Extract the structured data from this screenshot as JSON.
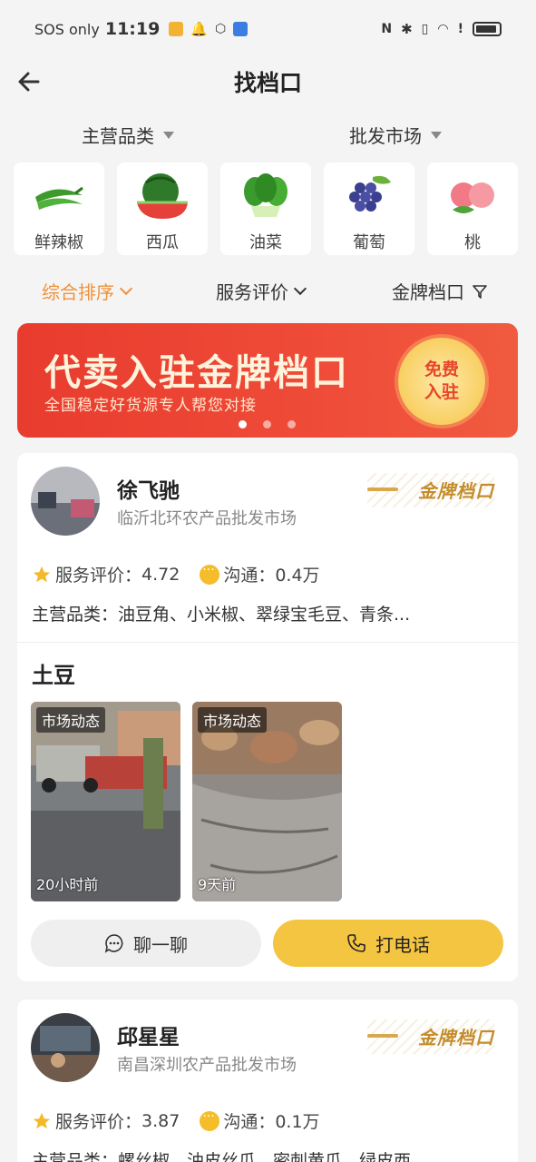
{
  "status_bar": {
    "carrier": "SOS only",
    "time": "11:19"
  },
  "header": {
    "title": "找档口"
  },
  "filters": {
    "category": "主营品类",
    "market": "批发市场"
  },
  "categories": [
    {
      "label": "鲜辣椒",
      "icon": "green-pepper-icon"
    },
    {
      "label": "西瓜",
      "icon": "watermelon-icon"
    },
    {
      "label": "油菜",
      "icon": "bok-choy-icon"
    },
    {
      "label": "葡萄",
      "icon": "grape-icon"
    },
    {
      "label": "桃",
      "icon": "peach-icon"
    }
  ],
  "sort": {
    "comprehensive": "综合排序",
    "service": "服务评价",
    "gold": "金牌档口"
  },
  "banner": {
    "headline": "代卖入驻金牌档口",
    "subline": "全国稳定好货源专人帮您对接",
    "badge_top": "免费",
    "badge_bottom": "入驻",
    "slides": 3,
    "active_slide": 1
  },
  "stalls": [
    {
      "name": "徐飞驰",
      "market": "临沂北环农产品批发市场",
      "gold_label": "金牌档口",
      "rating_label": "服务评价：",
      "rating": "4.72",
      "comm_label": "沟通：",
      "comm": "0.4万",
      "categories_line": "主营品类：油豆角、小米椒、翠绿宝毛豆、青条...",
      "product": "土豆",
      "posts": [
        {
          "tag": "市场动态",
          "ago": "20小时前"
        },
        {
          "tag": "市场动态",
          "ago": "9天前"
        }
      ],
      "chat_label": "聊一聊",
      "call_label": "打电话"
    },
    {
      "name": "邱星星",
      "market": "南昌深圳农产品批发市场",
      "gold_label": "金牌档口",
      "rating_label": "服务评价：",
      "rating": "3.87",
      "comm_label": "沟通：",
      "comm": "0.1万",
      "categories_line": "主营品类：螺丝椒、油皮丝瓜、密刺黄瓜、绿皮西"
    }
  ]
}
